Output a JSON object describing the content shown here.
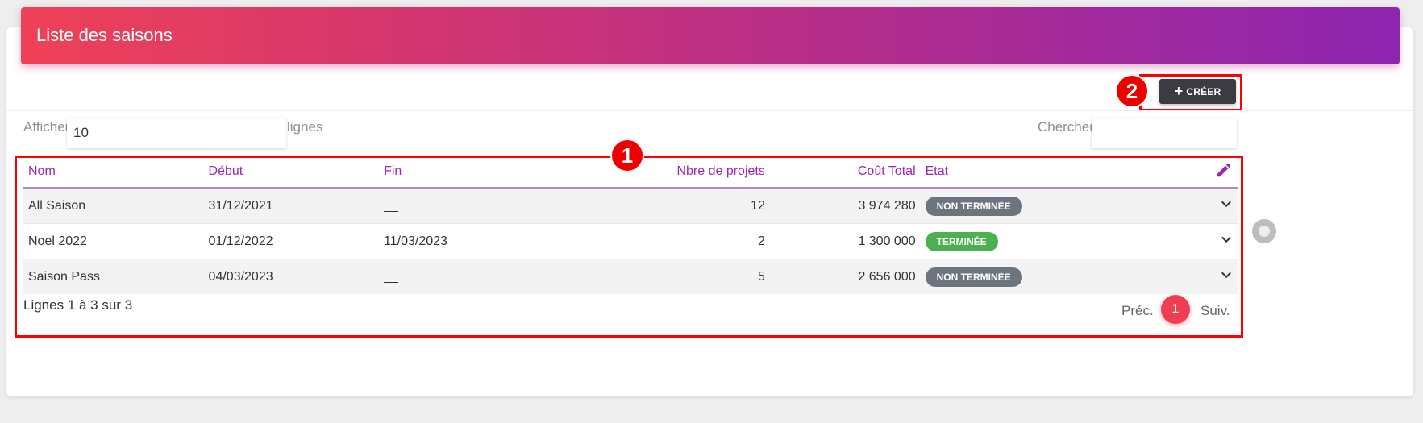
{
  "header": {
    "title": "Liste des saisons"
  },
  "toolbar": {
    "create_label": "CRÉER",
    "create_icon": "plus-icon"
  },
  "annotations": {
    "table_badge": "1",
    "create_badge": "2",
    "color": "#ff0000"
  },
  "controls": {
    "show_label": "Afficher",
    "show_value": "10",
    "show_suffix": "lignes",
    "search_label": "Chercher:",
    "search_value": ""
  },
  "table": {
    "columns": [
      "Nom",
      "Début",
      "Fin",
      "Nbre de projets",
      "Coût Total",
      "Etat"
    ],
    "edit_icon": "pencil-icon",
    "rows": [
      {
        "nom": "All Saison",
        "debut": "31/12/2021",
        "fin": "__",
        "projets": "12",
        "cout": "3 974 280",
        "etat": "NON TERMINÉE",
        "etat_color": "#6c757d"
      },
      {
        "nom": "Noel 2022",
        "debut": "01/12/2022",
        "fin": "11/03/2023",
        "projets": "2",
        "cout": "1 300 000",
        "etat": "TERMINÉE",
        "etat_color": "#4caf50"
      },
      {
        "nom": "Saison Pass",
        "debut": "04/03/2023",
        "fin": "__",
        "projets": "5",
        "cout": "2 656 000",
        "etat": "NON TERMINÉE",
        "etat_color": "#6c757d"
      }
    ]
  },
  "footer": {
    "info": "Lignes 1 à 3 sur 3"
  },
  "pagination": {
    "prev": "Préc.",
    "current": "1",
    "next": "Suiv."
  },
  "colors": {
    "accent": "#9c27b0",
    "header_start": "#ef4157",
    "header_end": "#8c25b0",
    "page_active": "#ef3e52"
  }
}
